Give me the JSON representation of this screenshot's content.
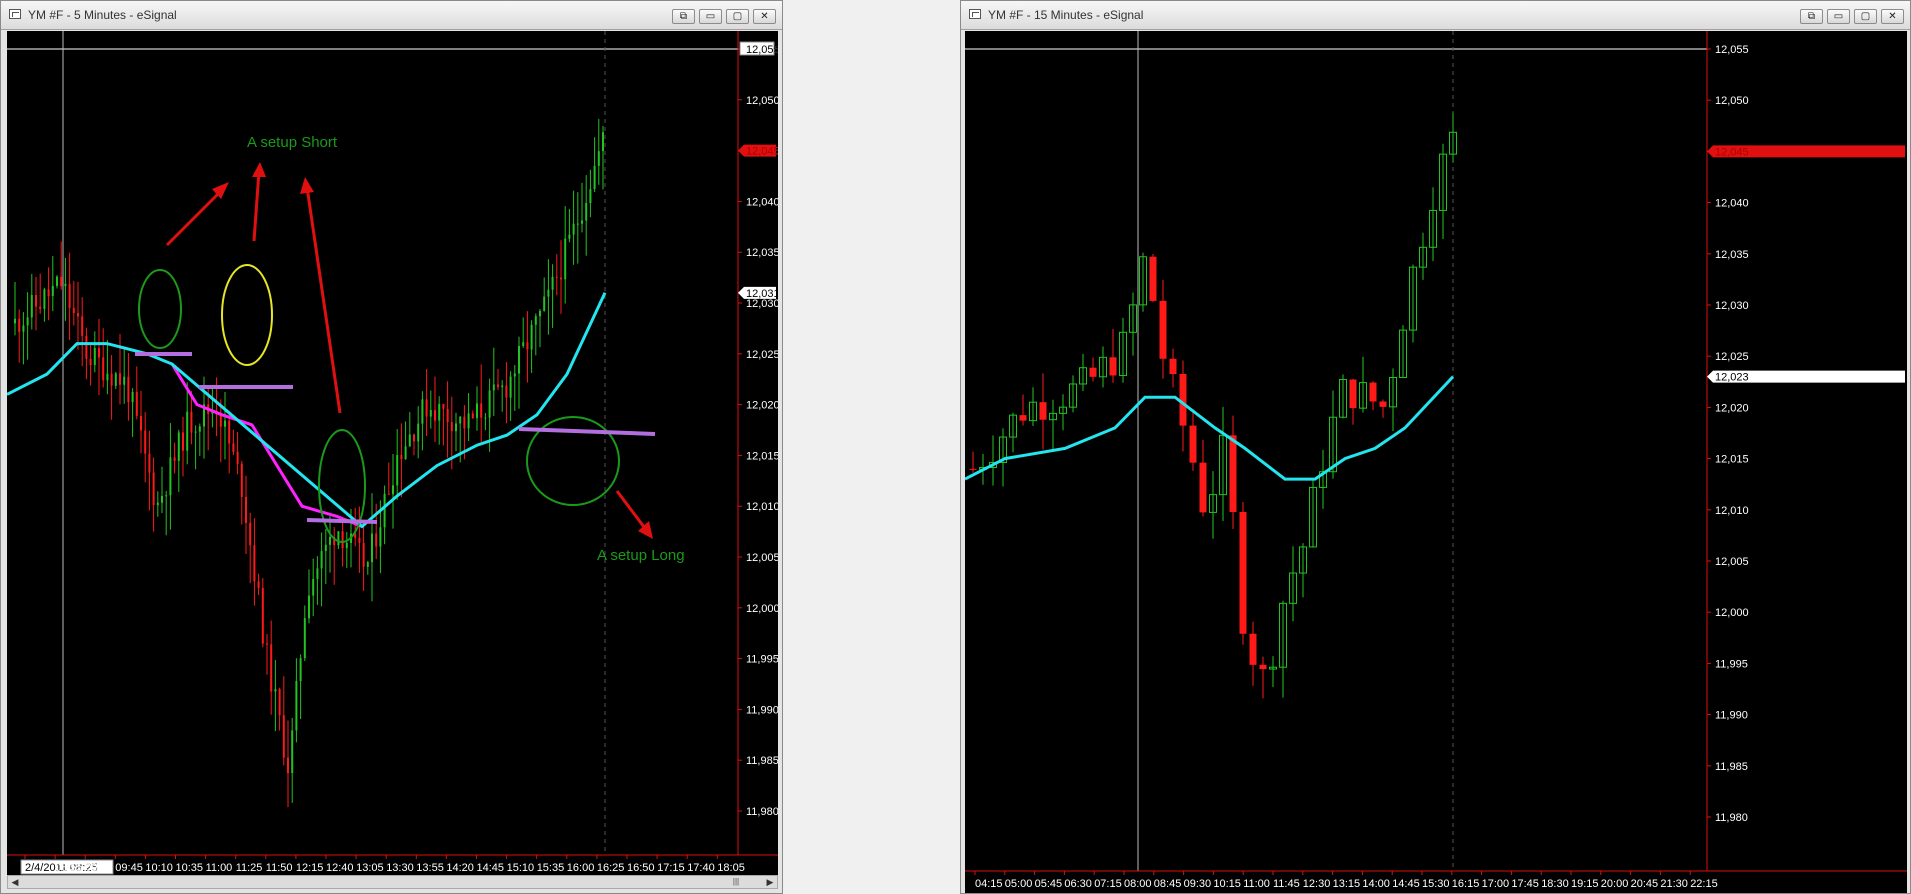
{
  "left": {
    "title": "YM #F - 5 Minutes - eSignal",
    "price_ticks": [
      "12,055",
      "12,050",
      "12,045",
      "12,040",
      "12,035",
      "12,030",
      "12,025",
      "12,020",
      "12,015",
      "12,010",
      "12,005",
      "12,000",
      "11,995",
      "11,990",
      "11,985",
      "11,980"
    ],
    "last_price": "12,045",
    "ma_price": "12,031",
    "time_ticks": [
      "2/4/2011 08:25",
      "08:55",
      "09:20",
      "09:45",
      "10:10",
      "10:35",
      "11:00",
      "11:25",
      "11:50",
      "12:15",
      "12:40",
      "13:05",
      "13:30",
      "13:55",
      "14:20",
      "14:45",
      "15:10",
      "15:35",
      "16:00",
      "16:25",
      "16:50",
      "17:15",
      "17:40",
      "18:05"
    ],
    "annotation_short": "A setup Short",
    "annotation_long": "A setup Long",
    "scroll_grip": "|||"
  },
  "right": {
    "title": "YM #F - 15 Minutes - eSignal",
    "price_ticks": [
      "12,055",
      "12,050",
      "12,045",
      "12,040",
      "12,035",
      "12,030",
      "12,025",
      "12,020",
      "12,015",
      "12,010",
      "12,005",
      "12,000",
      "11,995",
      "11,990",
      "11,985",
      "11,980"
    ],
    "last_price": "12,045",
    "ma_price": "12,023",
    "time_ticks": [
      "04:15",
      "05:00",
      "05:45",
      "06:30",
      "07:15",
      "08:00",
      "08:45",
      "09:30",
      "10:15",
      "11:00",
      "11:45",
      "12:30",
      "13:15",
      "14:00",
      "14:45",
      "15:30",
      "16:15",
      "17:00",
      "17:45",
      "18:30",
      "19:15",
      "20:00",
      "20:45",
      "21:30",
      "22:15"
    ]
  },
  "window_buttons": {
    "restore": "⧉",
    "minimize": "▭",
    "maximize": "▢",
    "close": "✕"
  },
  "colors": {
    "up": "#22c322",
    "down": "#ff1a1a",
    "ma5": "#ff22ff",
    "ma": "#22e5f0",
    "crosshair": "#ffffff",
    "annotation": "#1a9a1a"
  }
}
